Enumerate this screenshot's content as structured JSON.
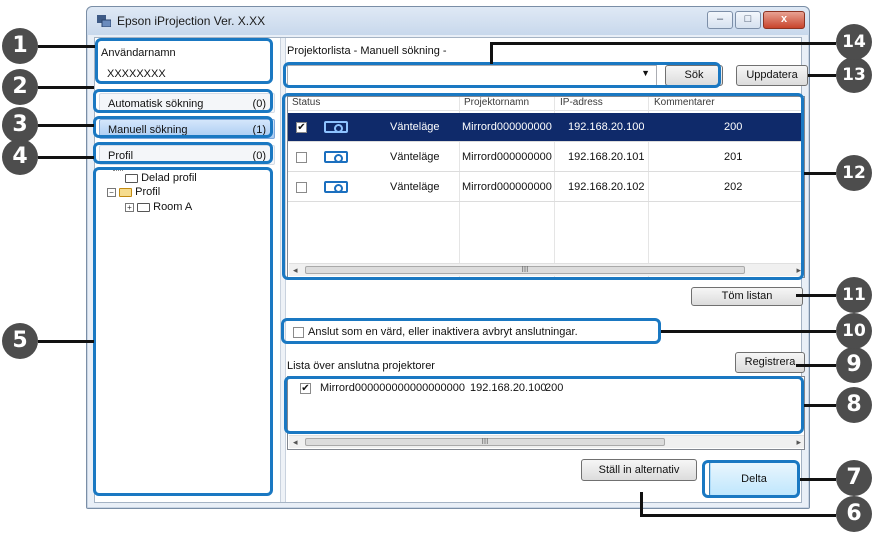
{
  "window": {
    "title": "Epson iProjection Ver. X.XX"
  },
  "window_controls": {
    "minimize": "–",
    "maximize": "□",
    "close": "x"
  },
  "left": {
    "username_label": "Användarnamn",
    "username_value": "XXXXXXXX",
    "modes": [
      {
        "label": "Automatisk sökning",
        "count": "(0)"
      },
      {
        "label": "Manuell sökning",
        "count": "(1)"
      },
      {
        "label": "Profil",
        "count": "(0)"
      }
    ],
    "tree": {
      "shared": "Delad profil",
      "profile": "Profil",
      "room": "Room A"
    }
  },
  "right": {
    "list_title": "Projektorlista - Manuell sökning -",
    "search_value": "",
    "search_button": "Sök",
    "update_button": "Uppdatera",
    "columns": [
      "Status",
      "Projektornamn",
      "IP-adress",
      "Kommentarer"
    ],
    "rows": [
      {
        "checked": true,
        "status": "Vänteläge",
        "name": "Mirrord000000000...",
        "ip": "192.168.20.100",
        "comment": "200"
      },
      {
        "checked": false,
        "status": "Vänteläge",
        "name": "Mirrord000000000...",
        "ip": "192.168.20.101",
        "comment": "201"
      },
      {
        "checked": false,
        "status": "Vänteläge",
        "name": "Mirrord000000000...",
        "ip": "192.168.20.102",
        "comment": "202"
      }
    ],
    "clear_button": "Töm listan",
    "host_checkbox_label": "Anslut som en värd, eller inaktivera avbryt anslutningar.",
    "connected_title": "Lista över anslutna projektorer",
    "register_button": "Registrera",
    "connected": [
      {
        "checked": true,
        "name": "Mirrord000000000000000000",
        "ip": "192.168.20.100",
        "comment": "200"
      }
    ],
    "options_button": "Ställ in alternativ",
    "join_button": "Delta"
  },
  "callouts": [
    "1",
    "2",
    "3",
    "4",
    "5",
    "6",
    "7",
    "8",
    "9",
    "10",
    "11",
    "12",
    "13",
    "14"
  ],
  "colors": {
    "highlight": "#1a78c2",
    "selected_row": "#0f2a6a",
    "callout": "#4d4d4d"
  }
}
